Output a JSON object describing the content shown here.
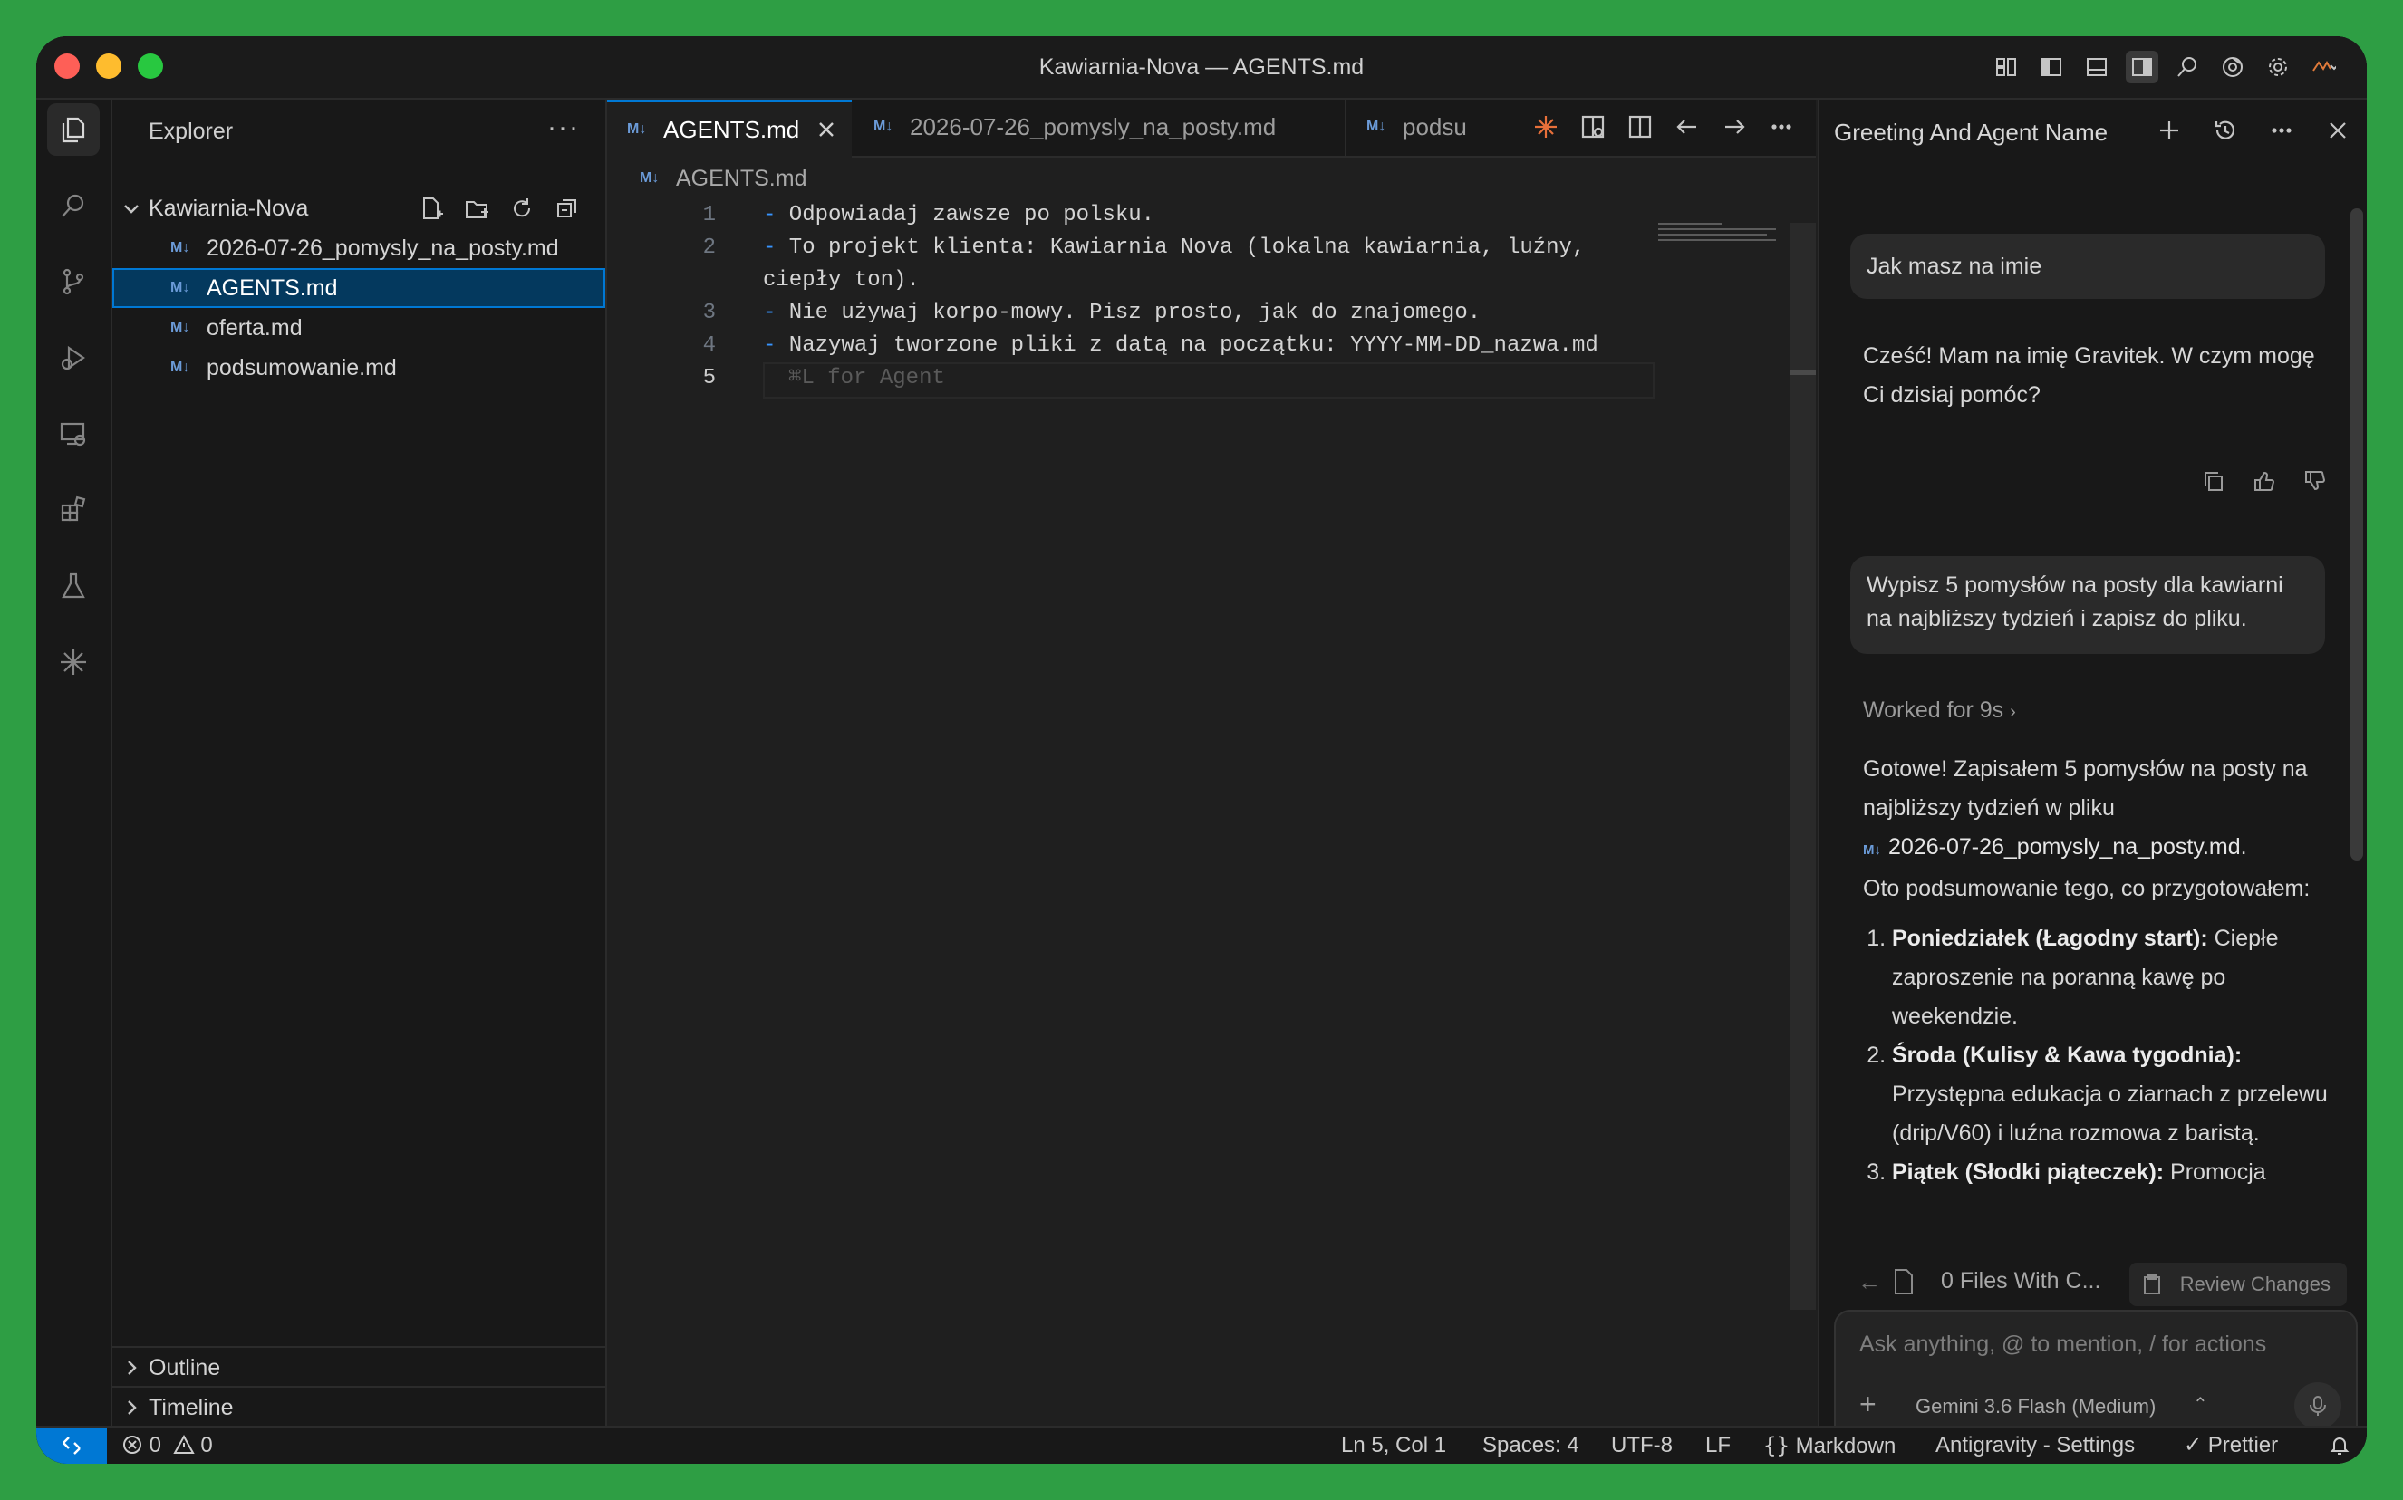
{
  "window": {
    "title": "Kawiarnia-Nova — AGENTS.md"
  },
  "sidebar": {
    "header": "Explorer",
    "more": "···",
    "folder": "Kawiarnia-Nova",
    "files": [
      {
        "badge": "M↓",
        "name": "2026-07-26_pomysly_na_posty.md"
      },
      {
        "badge": "M↓",
        "name": "AGENTS.md"
      },
      {
        "badge": "M↓",
        "name": "oferta.md"
      },
      {
        "badge": "M↓",
        "name": "podsumowanie.md"
      }
    ],
    "selected_file": "AGENTS.md",
    "panels": {
      "outline": "Outline",
      "timeline": "Timeline"
    }
  },
  "editor": {
    "tabs": [
      {
        "badge": "M↓",
        "label": "AGENTS.md"
      },
      {
        "badge": "M↓",
        "label": "2026-07-26_pomysly_na_posty.md"
      },
      {
        "badge": "M↓",
        "label": "podsu"
      }
    ],
    "breadcrumb": {
      "badge": "M↓",
      "label": "AGENTS.md"
    },
    "lines": [
      {
        "num": "1",
        "dash": "-",
        "text": " Odpowiadaj zawsze po polsku."
      },
      {
        "num": "2",
        "dash": "-",
        "text": " To projekt klienta: Kawiarnia Nova (lokalna kawiarnia, luźny,"
      },
      {
        "num": "",
        "dash": "",
        "text": "ciepły ton)."
      },
      {
        "num": "3",
        "dash": "-",
        "text": " Nie używaj korpo-mowy. Pisz prosto, jak do znajomego."
      },
      {
        "num": "4",
        "dash": "-",
        "text": " Nazywaj tworzone pliki z datą na początku: YYYY-MM-DD_nazwa.md"
      },
      {
        "num": "5",
        "dash": "",
        "text": ""
      }
    ],
    "ghost_hint": "⌘L for Agent"
  },
  "agent": {
    "title": "Greeting And Agent Name",
    "user_msg_1": "Jak masz na imie",
    "reply_1": "Cześć! Mam na imię Gravitek. W czym mogę Ci dzisiaj pomóc?",
    "user_msg_2": "Wypisz 5 pomysłów na posty dla kawiarni na najbliższy tydzień i zapisz do pliku.",
    "worked": "Worked for 9s",
    "reply_2_intro": "Gotowe! Zapisałem 5 pomysłów na posty na najbliższy tydzień w pliku",
    "reply_2_file_badge": "M↓",
    "reply_2_file": "2026-07-26_pomysly_na_posty.md",
    "reply_2_dot": ".",
    "reply_2_outro": "Oto podsumowanie tego, co przygotowałem:",
    "ideas": [
      {
        "title": "Poniedziałek (Łagodny start):",
        "text": " Ciepłe zaproszenie na poranną kawę po weekendzie."
      },
      {
        "title": "Środa (Kulisy & Kawa tygodnia):",
        "text": " Przystępna edukacja o ziarnach z przelewu (drip/V60) i luźna rozmowa z baristą."
      },
      {
        "title": "Piątek (Słodki piąteczek):",
        "text": " Promocja"
      }
    ],
    "files_changed": "0 Files With C...",
    "review_button": "Review Changes",
    "input_placeholder": "Ask anything, @ to mention, / for actions",
    "model": "Gemini 3.6 Flash (Medium)"
  },
  "statusbar": {
    "errors": "0",
    "warnings": "0",
    "position": "Ln 5, Col 1",
    "spaces": "Spaces: 4",
    "encoding": "UTF-8",
    "eol": "LF",
    "language": "Markdown",
    "settings": "Antigravity - Settings",
    "prettier": "Prettier"
  },
  "colors": {
    "accent": "#0078d4",
    "selected_bg": "#04395e",
    "md_badge": "#6b9bd8",
    "desktop": "#2e9e44"
  }
}
